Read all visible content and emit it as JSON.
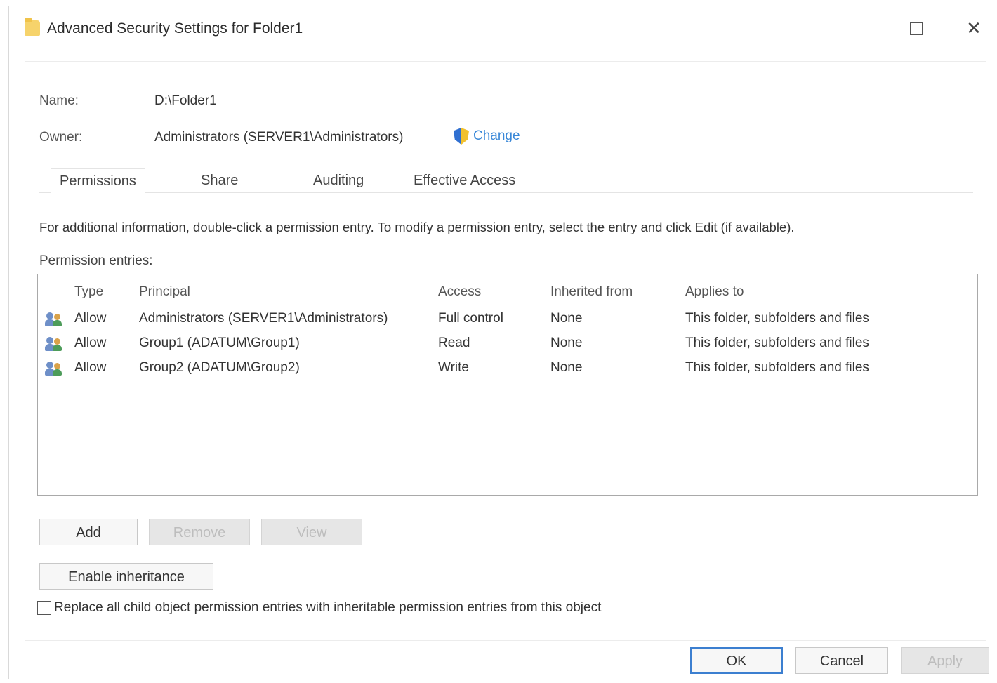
{
  "window": {
    "title": "Advanced Security Settings for Folder1"
  },
  "summary": {
    "name_label": "Name:",
    "name_value": "D:\\Folder1",
    "owner_label": "Owner:",
    "owner_value": "Administrators (SERVER1\\Administrators)",
    "change_link": "Change"
  },
  "tabs": [
    {
      "label": "Permissions",
      "active": true
    },
    {
      "label": "Share",
      "active": false
    },
    {
      "label": "Auditing",
      "active": false
    },
    {
      "label": "Effective Access",
      "active": false
    }
  ],
  "info_text": "For additional information, double-click a permission entry. To modify a permission entry, select the entry and click Edit (if available).",
  "entries_label": "Permission entries:",
  "table": {
    "columns": [
      "Type",
      "Principal",
      "Access",
      "Inherited from",
      "Applies to"
    ],
    "rows": [
      {
        "type": "Allow",
        "principal": "Administrators (SERVER1\\Administrators)",
        "access": "Full control",
        "inherited": "None",
        "applies": "This folder, subfolders and files"
      },
      {
        "type": "Allow",
        "principal": "Group1 (ADATUM\\Group1)",
        "access": "Read",
        "inherited": "None",
        "applies": "This folder, subfolders and files"
      },
      {
        "type": "Allow",
        "principal": "Group2 (ADATUM\\Group2)",
        "access": "Write",
        "inherited": "None",
        "applies": "This folder, subfolders and files"
      }
    ]
  },
  "buttons": {
    "add": "Add",
    "remove": "Remove",
    "view": "View",
    "enable_inheritance": "Enable inheritance",
    "ok": "OK",
    "cancel": "Cancel",
    "apply": "Apply"
  },
  "checkbox": {
    "label": "Replace all child object permission entries with inheritable permission entries from this object",
    "checked": false
  },
  "colors": {
    "link": "#3a88d8",
    "primary_border": "#3c7fd0",
    "folder": "#f6d36b"
  }
}
